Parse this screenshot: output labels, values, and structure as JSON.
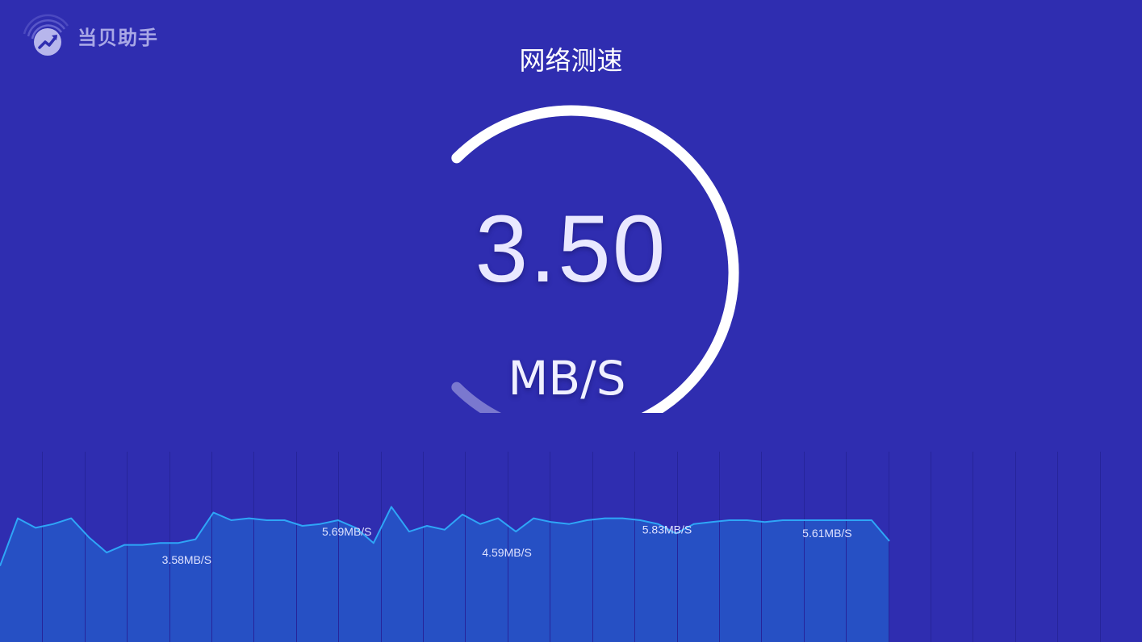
{
  "app": {
    "brand_name": "当贝助手",
    "logo_icon": "trend-chart-icon"
  },
  "page": {
    "title": "网络测速"
  },
  "speed": {
    "value": "3.50",
    "unit": "MB/S",
    "gauge_fraction": 0.74
  },
  "colors": {
    "background": "#2f2db0",
    "area_fill": "#2650c4",
    "line": "#2ea6f7",
    "gauge_track": "#7a78cf",
    "gauge_fill": "#ffffff"
  },
  "chart_data": {
    "type": "area",
    "y_unit": "MB/S",
    "grid": true,
    "grid_lines_x": 27,
    "x_range": [
      0,
      50
    ],
    "ylim": [
      0,
      10
    ],
    "x": [
      0,
      1,
      2,
      3,
      4,
      5,
      6,
      7,
      8,
      9,
      10,
      11,
      12,
      13,
      14,
      15,
      16,
      17,
      18,
      19,
      20,
      21,
      22,
      23,
      24,
      25,
      26,
      27,
      28,
      29,
      30,
      31,
      32,
      33,
      34,
      35,
      36,
      37,
      38,
      39,
      40,
      41,
      42,
      43,
      44,
      45,
      46,
      47,
      48,
      49,
      50
    ],
    "values": [
      4.0,
      6.5,
      6.0,
      6.2,
      6.5,
      5.5,
      4.7,
      5.1,
      5.1,
      5.2,
      5.2,
      5.4,
      6.8,
      6.4,
      6.5,
      6.4,
      6.4,
      6.1,
      6.2,
      6.4,
      6.0,
      5.2,
      7.1,
      5.8,
      6.1,
      5.9,
      6.7,
      6.2,
      6.5,
      5.8,
      6.5,
      6.3,
      6.2,
      6.4,
      6.5,
      6.5,
      6.4,
      6.2,
      5.7,
      6.2,
      6.3,
      6.4,
      6.4,
      6.3,
      6.4,
      6.4,
      6.4,
      6.4,
      6.4,
      6.4,
      5.3
    ],
    "annotations": [
      {
        "x": 10.5,
        "y": 4.1,
        "text": "3.58MB/S"
      },
      {
        "x": 19.5,
        "y": 5.6,
        "text": "5.69MB/S"
      },
      {
        "x": 28.5,
        "y": 4.5,
        "text": "4.59MB/S"
      },
      {
        "x": 37.5,
        "y": 5.7,
        "text": "5.83MB/S"
      },
      {
        "x": 46.5,
        "y": 5.5,
        "text": "5.61MB/S"
      }
    ]
  }
}
